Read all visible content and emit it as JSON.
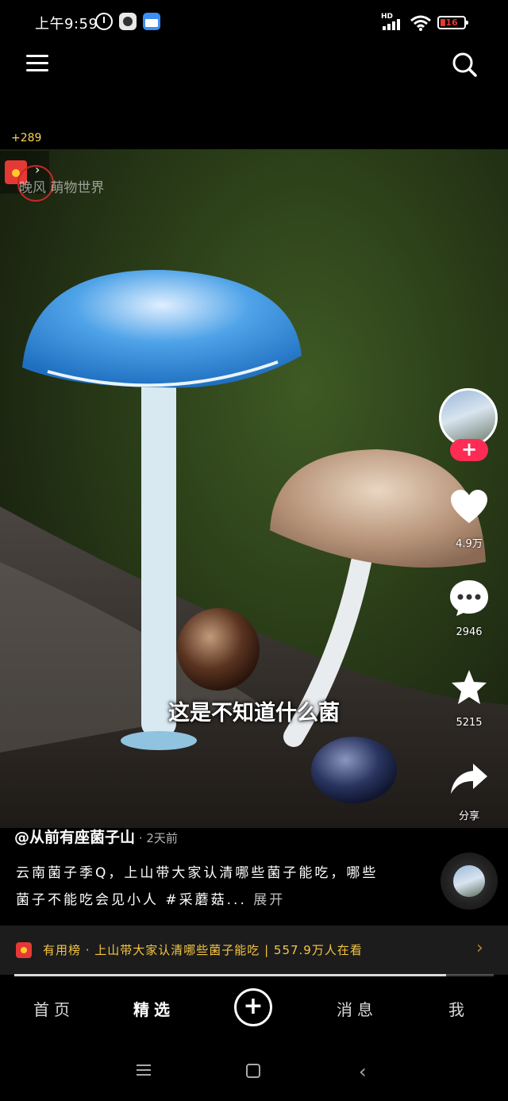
{
  "status_bar": {
    "time": "上午9:59",
    "network": "HD",
    "battery": "16"
  },
  "header": {
    "menu_icon": "menu-icon",
    "search_icon": "search-icon"
  },
  "reward": {
    "coins": "+289"
  },
  "video": {
    "watermark": "晚风 萌物世界",
    "subtitle": "这是不知道什么菌",
    "likes": "4.9万",
    "comments": "2946",
    "favorites": "5215",
    "share_label": "分享",
    "progress": 0.9
  },
  "post": {
    "author": "@从前有座菌子山",
    "time_ago": " · 2天前",
    "description": "云南菌子季Q，上山带大家认清哪些菌子能吃，哪些菌子不能吃会见小人 #采蘑菇... ",
    "expand_label": "展开"
  },
  "live_banner": {
    "text": "有用榜 · 上山带大家认清哪些菌子能吃 | 557.9万人在看"
  },
  "tabs": {
    "home": "首页",
    "featured": "精选",
    "add": "+",
    "messages": "消息",
    "me": "我"
  },
  "colors": {
    "accent": "#fe2c55",
    "banner_text": "#f5c542"
  }
}
